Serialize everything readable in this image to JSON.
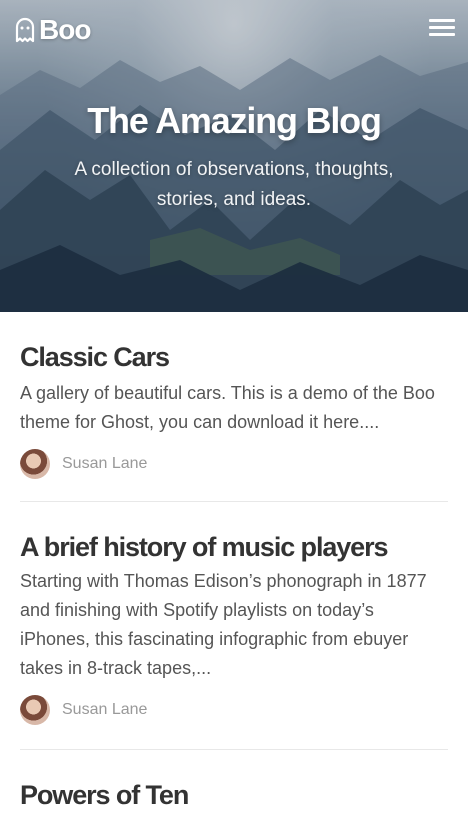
{
  "header": {
    "logo_text": "Boo",
    "logo_icon": "ghost-icon",
    "menu_icon": "hamburger-menu-icon"
  },
  "hero": {
    "title": "The Amazing Blog",
    "subtitle": "A collection of observations, thoughts, stories, and ideas."
  },
  "posts": [
    {
      "title": "Classic Cars",
      "excerpt": "A gallery of beautiful cars. This is a demo of the Boo theme for Ghost, you can download it here....",
      "author": "Susan Lane"
    },
    {
      "title": "A brief history of music players",
      "excerpt": "Starting with Thomas Edison’s phonograph in 1877 and finishing with Spotify playlists on today’s iPhones, this fascinating infographic from ebuyer takes in 8-track tapes,...",
      "author": "Susan Lane"
    },
    {
      "title": "Powers of Ten"
    }
  ]
}
